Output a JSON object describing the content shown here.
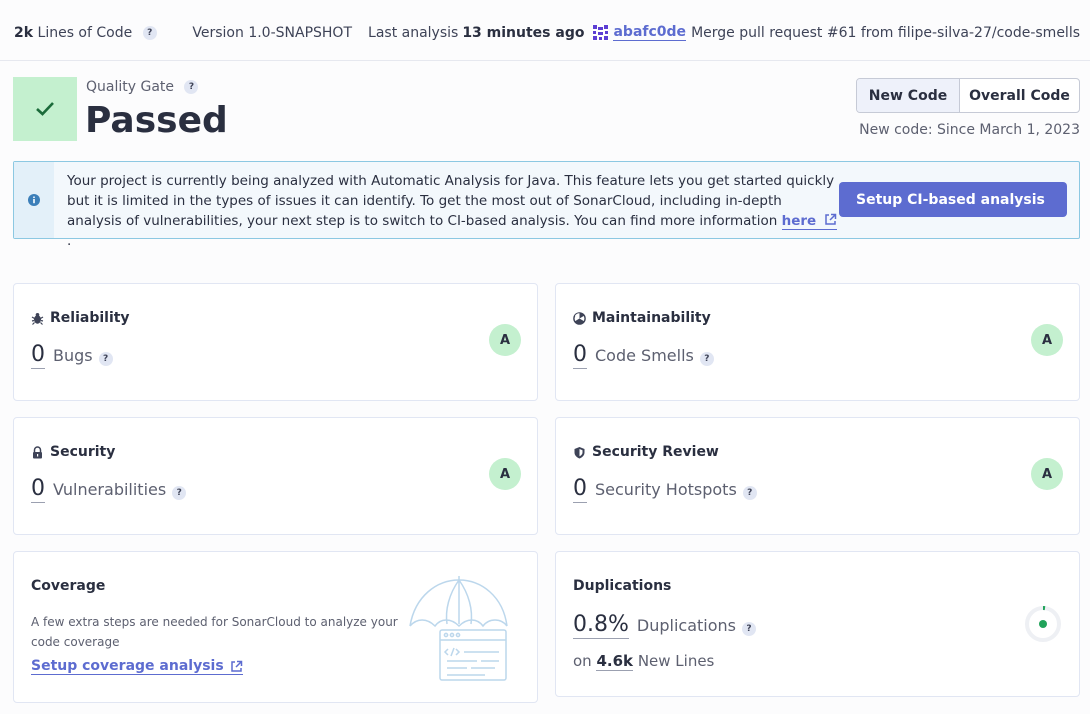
{
  "header": {
    "loc_value": "2k",
    "loc_label": "Lines of Code",
    "help": "?",
    "version": "Version 1.0-SNAPSHOT",
    "last_analysis_label": "Last analysis",
    "last_analysis_value": "13 minutes ago",
    "commit_hash": "abafc0de",
    "commit_message": "Merge pull request #61 from filipe-silva-27/code-smells"
  },
  "quality_gate": {
    "label": "Quality Gate",
    "status": "Passed",
    "status_color": "#c4f0cf"
  },
  "code_toggle": {
    "new_code": "New Code",
    "overall_code": "Overall Code",
    "since": "New code: Since March 1, 2023"
  },
  "banner": {
    "text": "Your project is currently being analyzed with Automatic Analysis for Java. This feature lets you get started quickly but it is limited in the types of issues it can identify. To get the most out of SonarCloud, including in-depth analysis of vulnerabilities, your next step is to switch to CI-based analysis. You can find more information ",
    "link_text": "here",
    "link_suffix": ".",
    "button": "Setup CI-based analysis",
    "accent": "#5d6cd0"
  },
  "cards": {
    "reliability": {
      "title": "Reliability",
      "value": "0",
      "unit": "Bugs",
      "rating": "A"
    },
    "maintainability": {
      "title": "Maintainability",
      "value": "0",
      "unit": "Code Smells",
      "rating": "A"
    },
    "security": {
      "title": "Security",
      "value": "0",
      "unit": "Vulnerabilities",
      "rating": "A"
    },
    "security_review": {
      "title": "Security Review",
      "value": "0",
      "unit": "Security Hotspots",
      "rating": "A"
    },
    "coverage": {
      "title": "Coverage",
      "description": "A few extra steps are needed for SonarCloud to analyze your code coverage",
      "link": "Setup coverage analysis"
    },
    "duplications": {
      "title": "Duplications",
      "value": "0.8%",
      "unit": "Duplications",
      "on_label": "on",
      "lines_value": "4.6k",
      "lines_label": "New Lines",
      "ratio": 0.008
    }
  },
  "icons": {
    "help": "help-icon",
    "commit": "commit-avatar-icon",
    "check": "check-icon",
    "info": "info-icon",
    "external": "external-link-icon",
    "bug": "bug-icon",
    "smell": "code-smell-icon",
    "lock": "lock-icon",
    "shield": "shield-icon",
    "umbrella": "umbrella-illustration",
    "donut": "duplication-donut-icon"
  }
}
